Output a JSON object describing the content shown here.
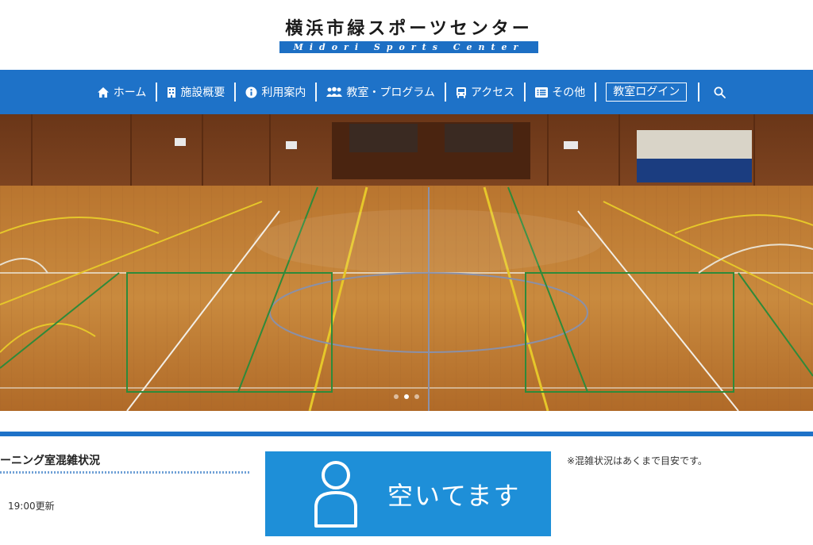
{
  "logo": {
    "title_jp": "横浜市緑スポーツセンター",
    "title_en": "Midori Sports Center"
  },
  "nav": {
    "items": [
      {
        "label": "ホーム",
        "icon": "home-icon"
      },
      {
        "label": "施設概要",
        "icon": "building-icon"
      },
      {
        "label": "利用案内",
        "icon": "info-icon"
      },
      {
        "label": "教室・プログラム",
        "icon": "people-icon"
      },
      {
        "label": "アクセス",
        "icon": "bus-icon"
      },
      {
        "label": "その他",
        "icon": "list-icon"
      }
    ],
    "login_label": "教室ログイン",
    "search_icon": "search-icon"
  },
  "hero": {
    "slides": 3,
    "active_slide": 2
  },
  "status": {
    "title": "ーニング室混雑状況",
    "updated": "19:00更新",
    "vacancy_label": "空いてます",
    "vacancy_icon": "person-icon",
    "note": "※混雑状況はあくまで目安です。"
  },
  "colors": {
    "nav_blue": "#1e72c8",
    "vacancy_blue": "#1e8fd8"
  }
}
